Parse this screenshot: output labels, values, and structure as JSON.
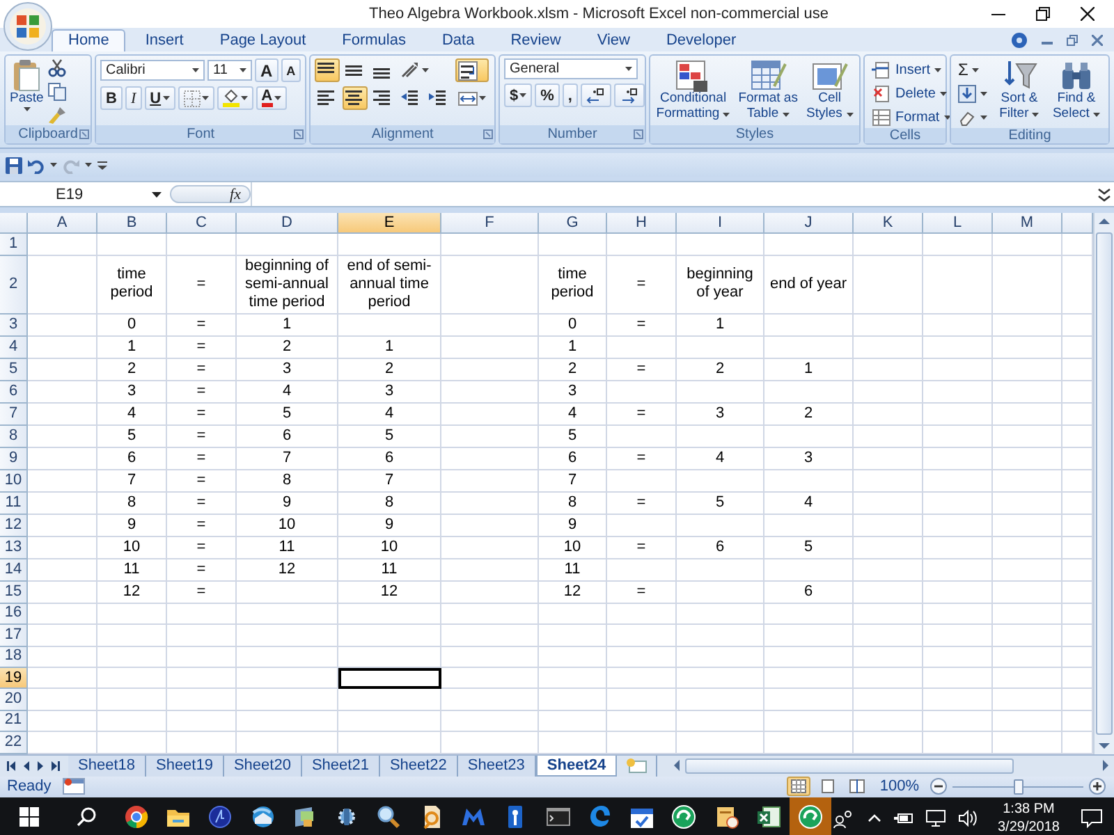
{
  "window": {
    "title": "Theo Algebra Workbook.xlsm - Microsoft Excel non-commercial use"
  },
  "ribbon_tabs": [
    {
      "label": "Home",
      "selected": true
    },
    {
      "label": "Insert",
      "selected": false
    },
    {
      "label": "Page Layout",
      "selected": false
    },
    {
      "label": "Formulas",
      "selected": false
    },
    {
      "label": "Data",
      "selected": false
    },
    {
      "label": "Review",
      "selected": false
    },
    {
      "label": "View",
      "selected": false
    },
    {
      "label": "Developer",
      "selected": false
    }
  ],
  "ribbon": {
    "clipboard": {
      "label": "Clipboard",
      "paste": "Paste"
    },
    "font": {
      "label": "Font",
      "name": "Calibri",
      "size": "11",
      "grow": "A",
      "shrink": "A",
      "bold": "B",
      "italic": "I",
      "underline": "U",
      "font_color_button": "A"
    },
    "alignment": {
      "label": "Alignment",
      "buttons": [
        {
          "kind": "top",
          "on": true
        },
        {
          "kind": "middle",
          "on": false
        },
        {
          "kind": "bottom",
          "on": false
        },
        {
          "kind": "orientation",
          "on": false
        },
        {
          "kind": "left",
          "on": false
        },
        {
          "kind": "center",
          "on": true
        },
        {
          "kind": "right",
          "on": false
        },
        {
          "kind": "outdent",
          "on": false
        },
        {
          "kind": "indent",
          "on": false
        },
        {
          "kind": "wrap",
          "on": true
        },
        {
          "kind": "merge",
          "on": false
        }
      ]
    },
    "number": {
      "label": "Number",
      "format": "General",
      "currency": "$",
      "percent": "%",
      "comma": ","
    },
    "styles": {
      "label": "Styles",
      "buttons": [
        {
          "kind": "conditional",
          "label": "Conditional Formatting"
        },
        {
          "kind": "table",
          "label": "Format as Table"
        },
        {
          "kind": "cell",
          "label": "Cell Styles"
        }
      ]
    },
    "cells": {
      "label": "Cells",
      "buttons": [
        {
          "kind": "insert",
          "label": "Insert"
        },
        {
          "kind": "delete",
          "label": "Delete"
        },
        {
          "kind": "format",
          "label": "Format"
        }
      ]
    },
    "editing": {
      "label": "Editing",
      "autosum": "Σ",
      "sort": "Sort & Filter",
      "find": "Find & Select"
    }
  },
  "formula_bar": {
    "name_box": "E19",
    "function_symbol": "fx"
  },
  "sheet": {
    "columns": [
      {
        "label": "A",
        "selected": false
      },
      {
        "label": "B",
        "selected": false
      },
      {
        "label": "C",
        "selected": false
      },
      {
        "label": "D",
        "selected": false
      },
      {
        "label": "E",
        "selected": true
      },
      {
        "label": "F",
        "selected": false
      },
      {
        "label": "G",
        "selected": false
      },
      {
        "label": "H",
        "selected": false
      },
      {
        "label": "I",
        "selected": false
      },
      {
        "label": "J",
        "selected": false
      },
      {
        "label": "K",
        "selected": false
      },
      {
        "label": "L",
        "selected": false
      },
      {
        "label": "M",
        "selected": false
      }
    ],
    "rows": [
      {
        "label": "1",
        "selected": false,
        "cells": [
          null,
          null,
          null,
          null,
          null,
          null,
          null,
          null,
          null,
          null,
          null,
          null,
          null
        ]
      },
      {
        "label": "2",
        "selected": false,
        "cells": [
          null,
          "time period",
          "=",
          "beginning of semi-annual time period",
          "end of semi-annual time period",
          null,
          "time period",
          "=",
          "beginning of year",
          "end of year",
          null,
          null,
          null
        ]
      },
      {
        "label": "3",
        "selected": false,
        "cells": [
          null,
          "0",
          "=",
          "1",
          null,
          null,
          "0",
          "=",
          "1",
          null,
          null,
          null,
          null
        ]
      },
      {
        "label": "4",
        "selected": false,
        "cells": [
          null,
          "1",
          "=",
          "2",
          "1",
          null,
          "1",
          null,
          null,
          null,
          null,
          null,
          null
        ]
      },
      {
        "label": "5",
        "selected": false,
        "cells": [
          null,
          "2",
          "=",
          "3",
          "2",
          null,
          "2",
          "=",
          "2",
          "1",
          null,
          null,
          null
        ]
      },
      {
        "label": "6",
        "selected": false,
        "cells": [
          null,
          "3",
          "=",
          "4",
          "3",
          null,
          "3",
          null,
          null,
          null,
          null,
          null,
          null
        ]
      },
      {
        "label": "7",
        "selected": false,
        "cells": [
          null,
          "4",
          "=",
          "5",
          "4",
          null,
          "4",
          "=",
          "3",
          "2",
          null,
          null,
          null
        ]
      },
      {
        "label": "8",
        "selected": false,
        "cells": [
          null,
          "5",
          "=",
          "6",
          "5",
          null,
          "5",
          null,
          null,
          null,
          null,
          null,
          null
        ]
      },
      {
        "label": "9",
        "selected": false,
        "cells": [
          null,
          "6",
          "=",
          "7",
          "6",
          null,
          "6",
          "=",
          "4",
          "3",
          null,
          null,
          null
        ]
      },
      {
        "label": "10",
        "selected": false,
        "cells": [
          null,
          "7",
          "=",
          "8",
          "7",
          null,
          "7",
          null,
          null,
          null,
          null,
          null,
          null
        ]
      },
      {
        "label": "11",
        "selected": false,
        "cells": [
          null,
          "8",
          "=",
          "9",
          "8",
          null,
          "8",
          "=",
          "5",
          "4",
          null,
          null,
          null
        ]
      },
      {
        "label": "12",
        "selected": false,
        "cells": [
          null,
          "9",
          "=",
          "10",
          "9",
          null,
          "9",
          null,
          null,
          null,
          null,
          null,
          null
        ]
      },
      {
        "label": "13",
        "selected": false,
        "cells": [
          null,
          "10",
          "=",
          "11",
          "10",
          null,
          "10",
          "=",
          "6",
          "5",
          null,
          null,
          null
        ]
      },
      {
        "label": "14",
        "selected": false,
        "cells": [
          null,
          "11",
          "=",
          "12",
          "11",
          null,
          "11",
          null,
          null,
          null,
          null,
          null,
          null
        ]
      },
      {
        "label": "15",
        "selected": false,
        "cells": [
          null,
          "12",
          "=",
          null,
          "12",
          null,
          "12",
          "=",
          null,
          "6",
          null,
          null,
          null
        ]
      },
      {
        "label": "16",
        "selected": false,
        "cells": [
          null,
          null,
          null,
          null,
          null,
          null,
          null,
          null,
          null,
          null,
          null,
          null,
          null
        ]
      },
      {
        "label": "17",
        "selected": false,
        "cells": [
          null,
          null,
          null,
          null,
          null,
          null,
          null,
          null,
          null,
          null,
          null,
          null,
          null
        ]
      },
      {
        "label": "18",
        "selected": false,
        "cells": [
          null,
          null,
          null,
          null,
          null,
          null,
          null,
          null,
          null,
          null,
          null,
          null,
          null
        ]
      },
      {
        "label": "19",
        "selected": true,
        "cells": [
          null,
          null,
          null,
          null,
          null,
          null,
          null,
          null,
          null,
          null,
          null,
          null,
          null
        ]
      },
      {
        "label": "20",
        "selected": false,
        "cells": [
          null,
          null,
          null,
          null,
          null,
          null,
          null,
          null,
          null,
          null,
          null,
          null,
          null
        ]
      },
      {
        "label": "21",
        "selected": false,
        "cells": [
          null,
          null,
          null,
          null,
          null,
          null,
          null,
          null,
          null,
          null,
          null,
          null,
          null
        ]
      },
      {
        "label": "22",
        "selected": false,
        "cells": [
          null,
          null,
          null,
          null,
          null,
          null,
          null,
          null,
          null,
          null,
          null,
          null,
          null
        ]
      }
    ]
  },
  "sheet_tabs": [
    {
      "label": "Sheet18",
      "selected": false
    },
    {
      "label": "Sheet19",
      "selected": false
    },
    {
      "label": "Sheet20",
      "selected": false
    },
    {
      "label": "Sheet21",
      "selected": false
    },
    {
      "label": "Sheet22",
      "selected": false
    },
    {
      "label": "Sheet23",
      "selected": false
    },
    {
      "label": "Sheet24",
      "selected": true
    }
  ],
  "status_bar": {
    "text": "Ready",
    "views": [
      {
        "kind": "normal",
        "selected": true
      },
      {
        "kind": "page_layout",
        "selected": false
      },
      {
        "kind": "page_break",
        "selected": false
      }
    ],
    "zoom": "100%",
    "zoom_slider": {
      "level": 0.5
    }
  },
  "taskbar": {
    "apps": [
      {
        "kind": "chrome",
        "running": true,
        "active": false
      },
      {
        "kind": "folder",
        "running": true,
        "active": false
      },
      {
        "kind": "bluecircle",
        "running": false,
        "active": false
      },
      {
        "kind": "mail",
        "running": true,
        "active": false
      },
      {
        "kind": "network",
        "running": false,
        "active": false
      },
      {
        "kind": "gear",
        "running": false,
        "active": false
      },
      {
        "kind": "magnifier",
        "running": false,
        "active": false
      },
      {
        "kind": "document",
        "running": false,
        "active": false
      },
      {
        "kind": "shield",
        "running": false,
        "active": false
      },
      {
        "kind": "key",
        "running": false,
        "active": false
      },
      {
        "kind": "terminal",
        "running": false,
        "active": false
      },
      {
        "kind": "edge",
        "running": false,
        "active": false
      },
      {
        "kind": "calendar",
        "running": false,
        "active": false
      },
      {
        "kind": "greencircle",
        "running": true,
        "active": false
      },
      {
        "kind": "notes",
        "running": true,
        "active": false
      },
      {
        "kind": "excel",
        "running": true,
        "active": false
      },
      {
        "kind": "greencircle",
        "running": true,
        "active": true
      }
    ],
    "time": "1:38 PM",
    "date": "3/29/2018"
  }
}
